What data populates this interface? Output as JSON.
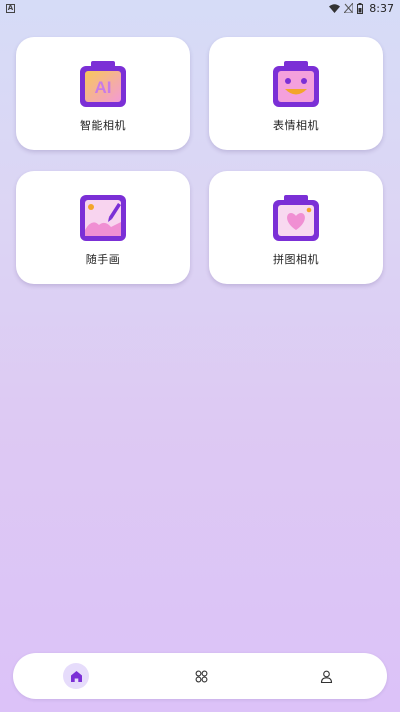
{
  "status_bar": {
    "notification_letter": "A",
    "time": "8:37",
    "icons": [
      "wifi-icon",
      "signal-icon",
      "battery-icon"
    ]
  },
  "tools": [
    {
      "label": "智能相机",
      "icon": "ai-camera-icon",
      "badge": "AI"
    },
    {
      "label": "表情相机",
      "icon": "emoji-camera-icon"
    },
    {
      "label": "随手画",
      "icon": "drawing-icon"
    },
    {
      "label": "拼图相机",
      "icon": "heart-camera-icon"
    }
  ],
  "bottom_nav": {
    "items": [
      "home-icon",
      "apps-grid-icon",
      "profile-icon"
    ],
    "active": "home-icon"
  },
  "colors": {
    "accent": "#7b2fd6",
    "accent_dark": "#6a22c4",
    "orange": "#f3a52a",
    "pink": "#f08fd3"
  }
}
